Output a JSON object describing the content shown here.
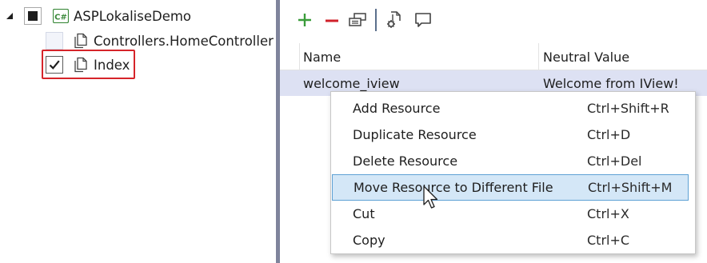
{
  "tree": {
    "root": {
      "label": "ASPLokaliseDemo",
      "check_state": "partial",
      "expander": "collapse-triangle-icon",
      "icon": "csharp-project-icon"
    },
    "children": [
      {
        "label": "Controllers.HomeController",
        "check_state": "unchecked",
        "icon": "resource-file-icon"
      },
      {
        "label": "Index",
        "check_state": "checked",
        "icon": "resource-file-icon",
        "highlighted": true
      }
    ]
  },
  "toolbar": {
    "buttons": [
      {
        "icon": "add-icon",
        "color": "#3a9c3a"
      },
      {
        "icon": "remove-icon",
        "color": "#d0212a"
      },
      {
        "icon": "copy-resource-icon",
        "color": "#424242"
      },
      {
        "icon": "translate-settings-icon",
        "color": "#424242"
      },
      {
        "icon": "comment-icon",
        "color": "#424242"
      }
    ]
  },
  "grid": {
    "columns": [
      "Name",
      "Neutral Value"
    ],
    "rows": [
      {
        "name": "welcome_iview",
        "neutral_value": "Welcome from IView!",
        "selected": true
      }
    ]
  },
  "context_menu": {
    "items": [
      {
        "label": "Add Resource",
        "shortcut": "Ctrl+Shift+R"
      },
      {
        "label": "Duplicate Resource",
        "shortcut": "Ctrl+D"
      },
      {
        "label": "Delete Resource",
        "shortcut": "Ctrl+Del"
      },
      {
        "label": "Move Resource to Different File",
        "shortcut": "Ctrl+Shift+M",
        "hovered": true
      },
      {
        "label": "Cut",
        "shortcut": "Ctrl+X"
      },
      {
        "label": "Copy",
        "shortcut": "Ctrl+C"
      }
    ]
  },
  "colors": {
    "highlight_box": "#d6242a",
    "selected_row": "#dde1f3",
    "menu_hover": "#d4e7f7",
    "splitter": "#7f849c"
  }
}
